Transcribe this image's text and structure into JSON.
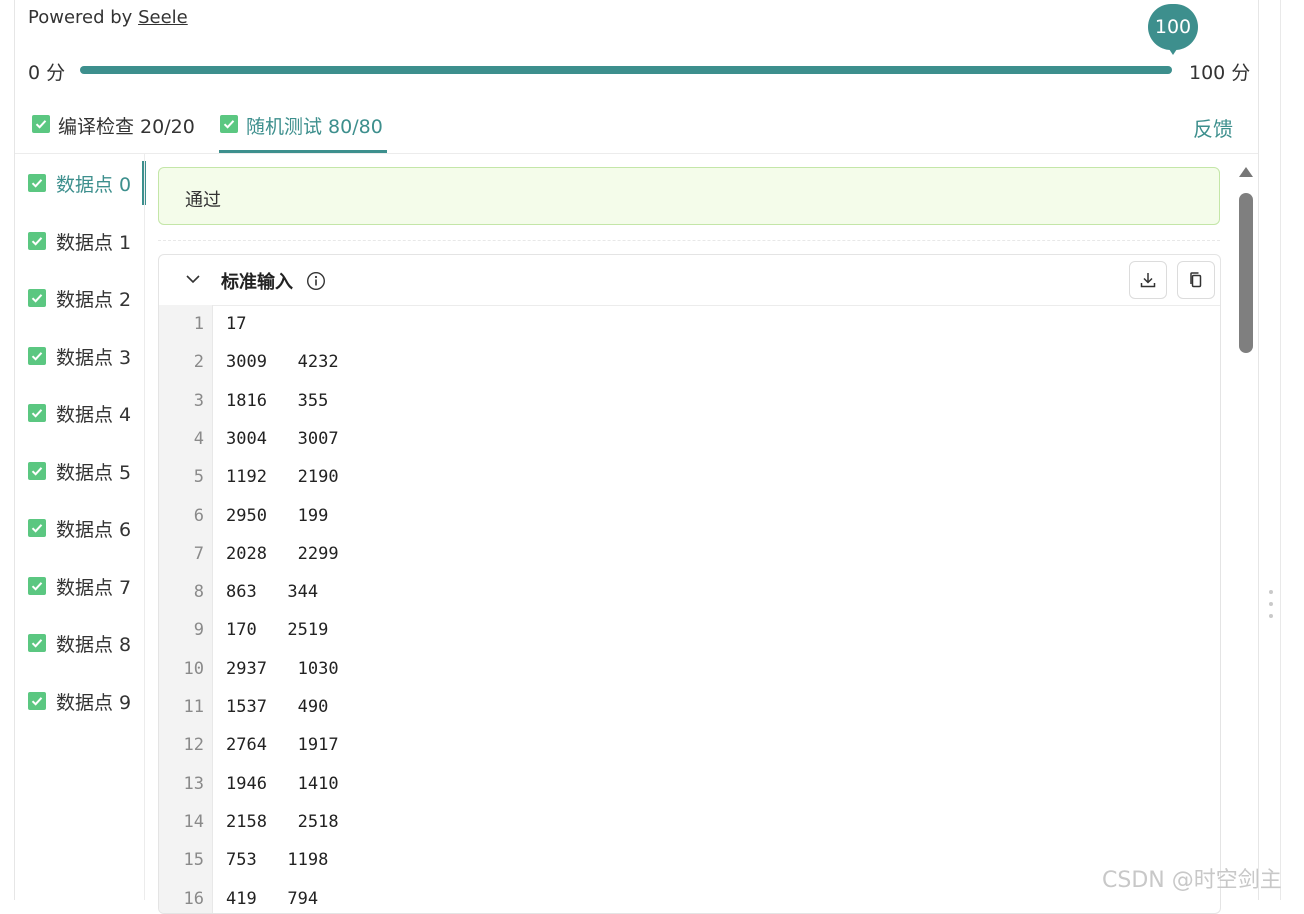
{
  "header": {
    "powered_prefix": "Powered by ",
    "powered_brand": "Seele"
  },
  "score": {
    "min_label": "0 分",
    "max_label": "100 分",
    "value": 100,
    "value_label": "100",
    "fill_fraction": 1.0,
    "accent_color": "#3d8f8d"
  },
  "tabs": [
    {
      "label": "编译检查 20/20",
      "icon": "check-icon",
      "active": false
    },
    {
      "label": "随机测试 80/80",
      "icon": "check-icon",
      "active": true
    }
  ],
  "feedback_label": "反馈",
  "datapoints": [
    {
      "label": "数据点 0",
      "active": true
    },
    {
      "label": "数据点 1"
    },
    {
      "label": "数据点 2"
    },
    {
      "label": "数据点 3"
    },
    {
      "label": "数据点 4"
    },
    {
      "label": "数据点 5"
    },
    {
      "label": "数据点 6"
    },
    {
      "label": "数据点 7"
    },
    {
      "label": "数据点 8"
    },
    {
      "label": "数据点 9"
    }
  ],
  "result": {
    "status": "通过"
  },
  "input_panel": {
    "title": "标准输入",
    "info_icon": "info-icon",
    "download_icon": "download-icon",
    "copy_icon": "copy-icon",
    "lines": [
      {
        "n": "1",
        "text": "17"
      },
      {
        "n": "2",
        "text": "3009   4232"
      },
      {
        "n": "3",
        "text": "1816   355"
      },
      {
        "n": "4",
        "text": "3004   3007"
      },
      {
        "n": "5",
        "text": "1192   2190"
      },
      {
        "n": "6",
        "text": "2950   199"
      },
      {
        "n": "7",
        "text": "2028   2299"
      },
      {
        "n": "8",
        "text": "863   344"
      },
      {
        "n": "9",
        "text": "170   2519"
      },
      {
        "n": "10",
        "text": "2937   1030"
      },
      {
        "n": "11",
        "text": "1537   490"
      },
      {
        "n": "12",
        "text": "2764   1917"
      },
      {
        "n": "13",
        "text": "1946   1410"
      },
      {
        "n": "14",
        "text": "2158   2518"
      },
      {
        "n": "15",
        "text": "753   1198"
      },
      {
        "n": "16",
        "text": "419   794"
      }
    ]
  },
  "watermark": "CSDN @时空剑主"
}
